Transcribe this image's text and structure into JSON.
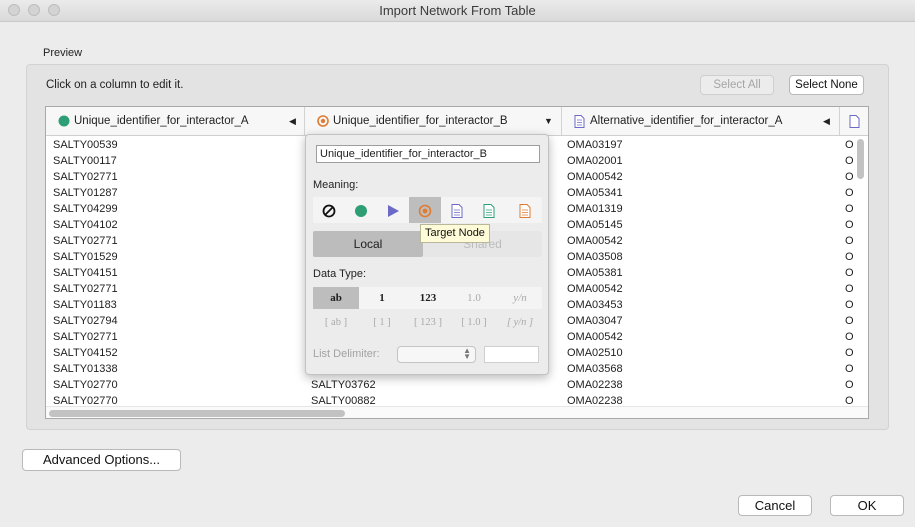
{
  "window": {
    "title": "Import Network From Table"
  },
  "preview": {
    "label": "Preview",
    "hint": "Click on a column to edit it.",
    "select_all": "Select All",
    "select_none": "Select None"
  },
  "table": {
    "columns": [
      {
        "label": "Unique_identifier_for_interactor_A",
        "icon": "source-node-icon",
        "color": "#2e9f75"
      },
      {
        "label": "Unique_identifier_for_interactor_B",
        "icon": "target-node-icon",
        "color": "#e07b31"
      },
      {
        "label": "Alternative_identifier_for_interactor_A",
        "icon": "document-icon",
        "color": "#6b6bc7"
      },
      {
        "label": "",
        "icon": "document-icon",
        "color": "#6b6bc7"
      }
    ],
    "col_a": [
      "SALTY00539",
      "SALTY00117",
      "SALTY02771",
      "SALTY01287",
      "SALTY04299",
      "SALTY04102",
      "SALTY02771",
      "SALTY01529",
      "SALTY04151",
      "SALTY02771",
      "SALTY01183",
      "SALTY02794",
      "SALTY02771",
      "SALTY04152",
      "SALTY01338",
      "SALTY02770",
      "SALTY02770"
    ],
    "col_b_visible": [
      "SALTY03762",
      "SALTY00882"
    ],
    "col_c": [
      "OMA03197",
      "OMA02001",
      "OMA00542",
      "OMA05341",
      "OMA01319",
      "OMA05145",
      "OMA00542",
      "OMA03508",
      "OMA05381",
      "OMA00542",
      "OMA03453",
      "OMA03047",
      "OMA00542",
      "OMA02510",
      "OMA03568",
      "OMA02238",
      "OMA02238"
    ],
    "col_d": [
      "O",
      "O",
      "O",
      "O",
      "O",
      "O",
      "O",
      "O",
      "O",
      "O",
      "O",
      "O",
      "O",
      "O",
      "O",
      "O",
      "O"
    ]
  },
  "editor": {
    "name_value": "Unique_identifier_for_interactor_B",
    "meaning_label": "Meaning:",
    "meaning_selected": "target-node",
    "local_label": "Local",
    "shared_label": "Shared",
    "data_type_label": "Data Type:",
    "types_row1": [
      "ab",
      "1",
      "123",
      "1.0",
      "y/n"
    ],
    "types_row2": [
      "[ ab ]",
      "[ 1 ]",
      "[ 123 ]",
      "[ 1.0 ]",
      "[ y/n ]"
    ],
    "list_delimiter_label": "List Delimiter:",
    "tooltip": "Target Node"
  },
  "footer": {
    "advanced": "Advanced Options...",
    "cancel": "Cancel",
    "ok": "OK"
  }
}
